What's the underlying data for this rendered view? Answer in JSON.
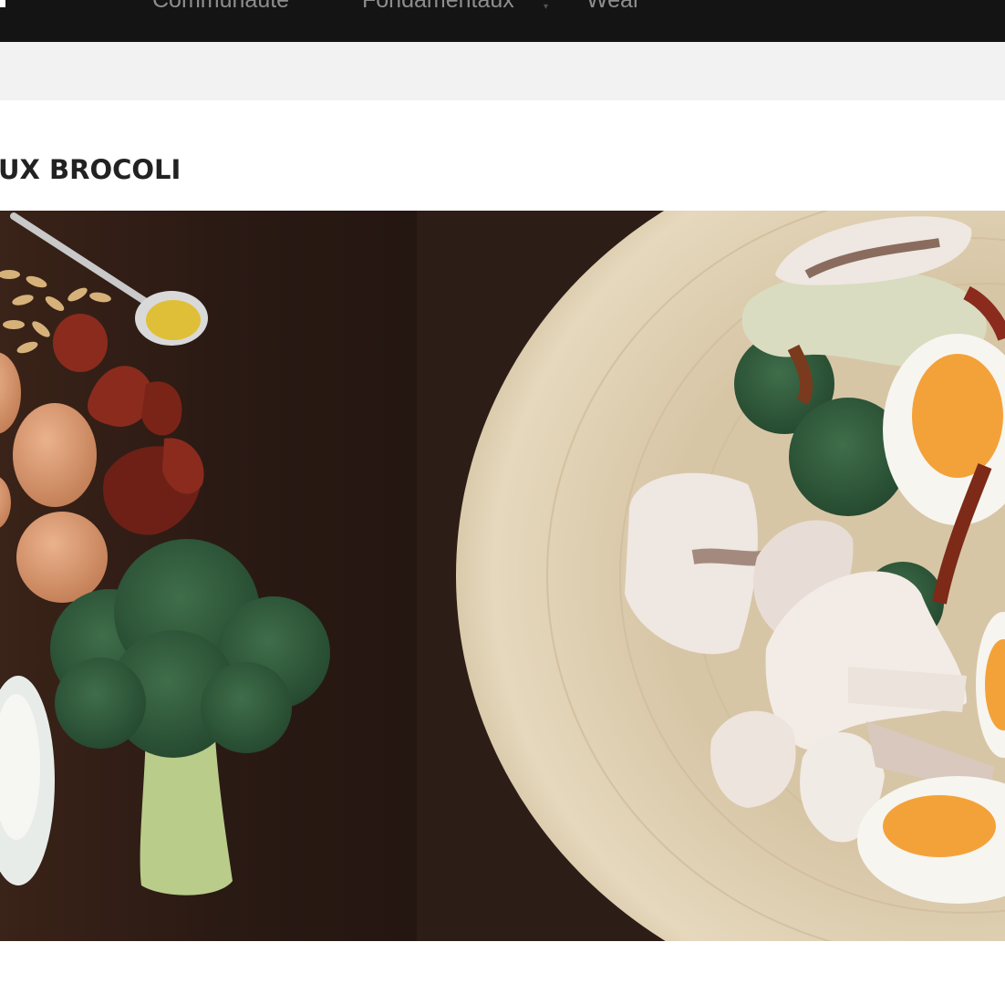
{
  "nav": {
    "items": [
      {
        "label": "Communauté"
      },
      {
        "label": "Fondamentaux"
      },
      {
        "label": "Wear"
      }
    ],
    "caret": "▾"
  },
  "article": {
    "title": "UX BROCOLI"
  },
  "hero": {
    "alt": "Ingredients and salad with broccoli, eggs, mushrooms and sun-dried tomatoes",
    "colors": {
      "table": "#2b1a14",
      "plate": "#dcccae",
      "broccoli": "#2f5a3a",
      "egg": "#d89a72",
      "yolk": "#f3a23a",
      "mushroom": "#efe7e1"
    }
  }
}
